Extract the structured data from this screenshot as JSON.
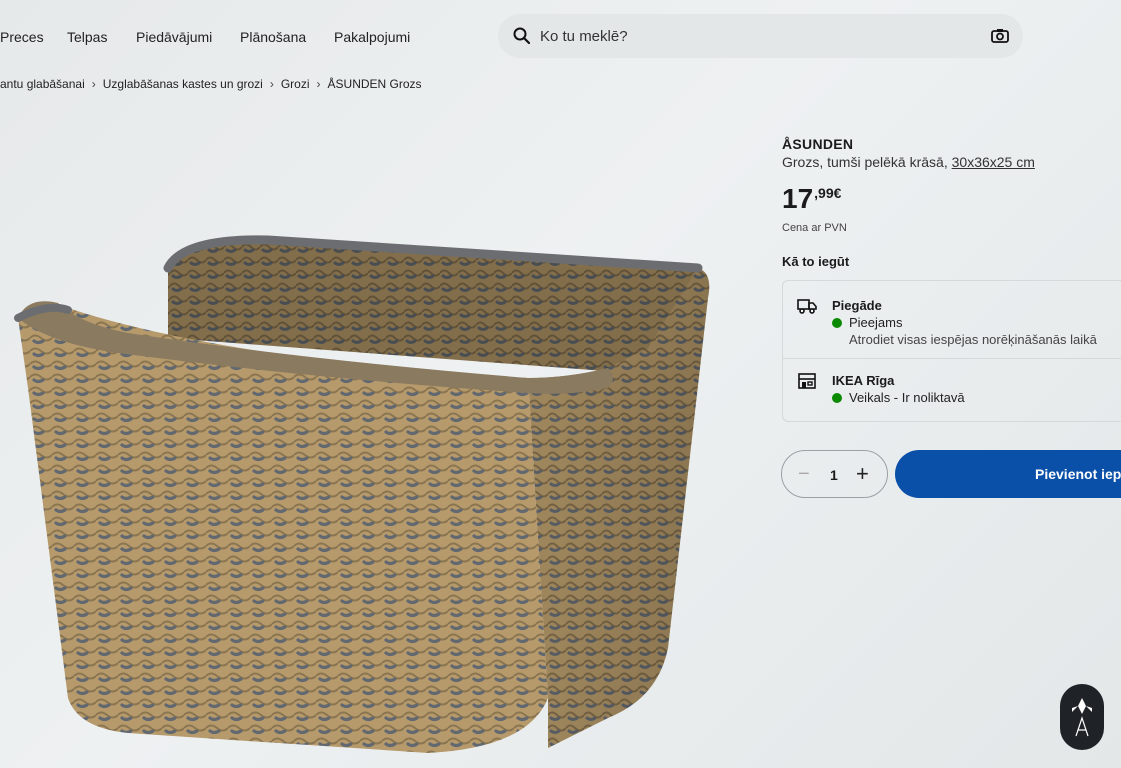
{
  "nav": {
    "items": [
      "Preces",
      "Telpas",
      "Piedāvājumi",
      "Plānošana",
      "Pakalpojumi"
    ]
  },
  "search": {
    "placeholder": "Ko tu meklē?",
    "icon": "search-icon",
    "camera_icon": "camera-icon"
  },
  "breadcrumb": [
    "antu glabāšanai",
    "Uzglabāšanas kastes un grozi",
    "Grozi",
    "ÅSUNDEN Grozs"
  ],
  "product": {
    "name": "ÅSUNDEN",
    "description": "Grozs, tumši pelēkā krāsā,",
    "size": "30x36x25 cm",
    "price_int": "17",
    "price_frac": ",99€",
    "vat_note": "Cena ar PVN",
    "how_to_get": "Kā to iegūt"
  },
  "availability": {
    "delivery": {
      "title": "Piegāde",
      "status": "Pieejams",
      "note": "Atrodiet visas iespējas norēķināšanās laikā",
      "icon": "truck-icon"
    },
    "store": {
      "title": "IKEA Rīga",
      "status": "Veikals - Ir noliktavā",
      "icon": "store-icon"
    },
    "status_color": "#0a8a00"
  },
  "cart": {
    "minus": "−",
    "quantity": "1",
    "plus": "+",
    "add_label": "Pievienot iepir",
    "button_color": "#0a4fa8"
  },
  "badge": {
    "icon": "watermark-logo-icon"
  }
}
